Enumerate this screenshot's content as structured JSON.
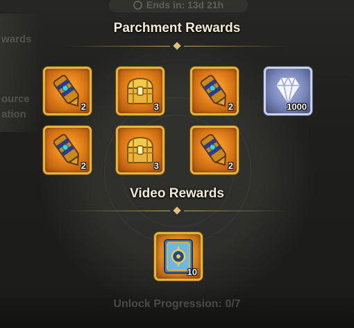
{
  "background": {
    "timer_text": "Ends in: 13d 21h",
    "side_labels": [
      "wards",
      "ource",
      "ation"
    ],
    "unlock_text": "Unlock Progression: 0/7"
  },
  "parchment": {
    "title": "Parchment Rewards",
    "items": [
      {
        "icon": "gauntlet-icon",
        "quantity": "2"
      },
      {
        "icon": "treasure-chest-icon",
        "quantity": "3"
      },
      {
        "icon": "gauntlet-icon",
        "quantity": "2"
      },
      {
        "icon": "diamond-icon",
        "quantity": "1000"
      },
      {
        "icon": "gauntlet-icon",
        "quantity": "2"
      },
      {
        "icon": "treasure-chest-icon",
        "quantity": "3"
      },
      {
        "icon": "gauntlet-icon",
        "quantity": "2"
      }
    ]
  },
  "video": {
    "title": "Video Rewards",
    "items": [
      {
        "icon": "card-icon",
        "quantity": "10"
      }
    ]
  },
  "colors": {
    "gold_border": "#e3b53c",
    "title_text": "#f4ecd8",
    "divider": "#c9a760"
  }
}
